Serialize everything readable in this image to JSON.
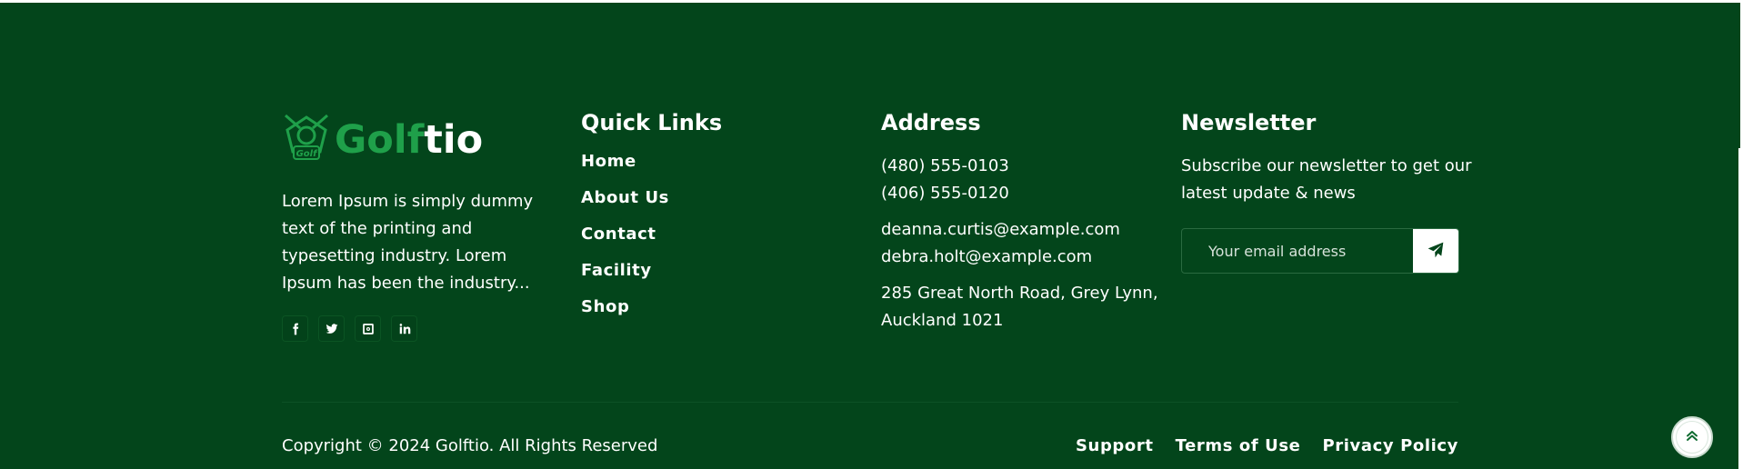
{
  "brand": {
    "logo_part1": "Golf",
    "logo_part2": "tio",
    "logo_icon": "golf-badge-icon",
    "about": "Lorem Ipsum is simply dummy text of the printing and typesetting industry. Lorem Ipsum has been the industry...",
    "socials": [
      "facebook-icon",
      "twitter-icon",
      "instagram-icon",
      "linkedin-icon"
    ]
  },
  "quick_links": {
    "title": "Quick Links",
    "items": [
      "Home",
      "About Us",
      "Contact",
      "Facility",
      "Shop"
    ]
  },
  "address": {
    "title": "Address",
    "phones": [
      "(480) 555-0103",
      "(406) 555-0120"
    ],
    "emails": [
      "deanna.curtis@example.com",
      "debra.holt@example.com"
    ],
    "street": "285 Great North Road, Grey Lynn,",
    "city": "Auckland 1021"
  },
  "newsletter": {
    "title": "Newsletter",
    "text": "Subscribe our newsletter to get our latest update & news",
    "placeholder": "Your email address",
    "submit_icon": "send-icon"
  },
  "bottom": {
    "copyright": "Copyright © 2024 Golftio. All Rights Reserved",
    "links": [
      "Support",
      "Terms of Use",
      "Privacy Policy"
    ]
  },
  "scroll_top_icon": "double-chevron-up-icon",
  "colors": {
    "footer_bg": "#03451b",
    "brand_green": "#1fa04a",
    "text": "#ffffff"
  }
}
